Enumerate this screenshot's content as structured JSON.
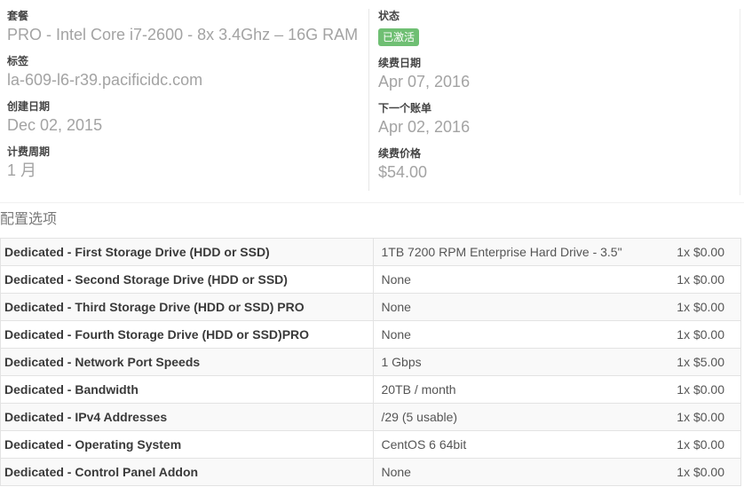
{
  "summary": {
    "left": [
      {
        "label": "套餐",
        "value": "PRO - Intel Core i7-2600 - 8x 3.4Ghz – 16G RAM"
      },
      {
        "label": "标签",
        "value": "la-609-l6-r39.pacificidc.com"
      },
      {
        "label": "创建日期",
        "value": "Dec 02, 2015"
      },
      {
        "label": "计费周期",
        "value": "1 月"
      }
    ],
    "status_label": "状态",
    "status_value": "已激活",
    "status_color": "#6fbf73",
    "right": [
      {
        "label": "续费日期",
        "value": "Apr 07, 2016"
      },
      {
        "label": "下一个账单",
        "value": "Apr 02, 2016"
      },
      {
        "label": "续费价格",
        "value": "$54.00"
      }
    ]
  },
  "config": {
    "title": "配置选项",
    "rows": [
      {
        "name": "Dedicated - First Storage Drive (HDD or SSD)",
        "value": "1TB 7200 RPM Enterprise Hard Drive - 3.5\"",
        "price": "1x $0.00"
      },
      {
        "name": "Dedicated - Second Storage Drive (HDD or SSD)",
        "value": "None",
        "price": "1x $0.00"
      },
      {
        "name": "Dedicated - Third Storage Drive (HDD or SSD) PRO",
        "value": "None",
        "price": "1x $0.00"
      },
      {
        "name": "Dedicated - Fourth Storage Drive (HDD or SSD)PRO",
        "value": "None",
        "price": "1x $0.00"
      },
      {
        "name": "Dedicated - Network Port Speeds",
        "value": "1 Gbps",
        "price": "1x $5.00"
      },
      {
        "name": "Dedicated - Bandwidth",
        "value": "20TB / month",
        "price": "1x $0.00"
      },
      {
        "name": "Dedicated - IPv4 Addresses",
        "value": "/29 (5 usable)",
        "price": "1x $0.00"
      },
      {
        "name": "Dedicated - Operating System",
        "value": "CentOS 6 64bit",
        "price": "1x $0.00"
      },
      {
        "name": "Dedicated - Control Panel Addon",
        "value": "None",
        "price": "1x $0.00"
      }
    ]
  }
}
